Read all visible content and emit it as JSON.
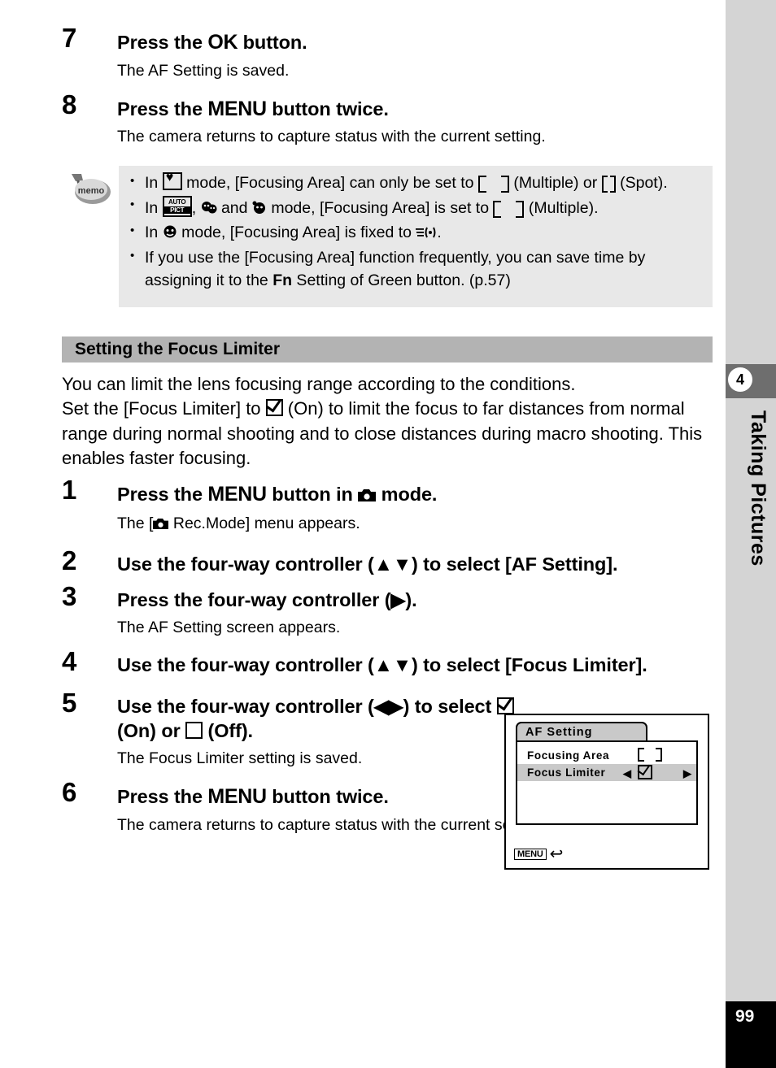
{
  "page": {
    "number": "99",
    "chapter_number": "4",
    "chapter_label": "Taking Pictures"
  },
  "steps_top": [
    {
      "num": "7",
      "title_pre": "Press the ",
      "title_kw": "OK",
      "title_post": " button.",
      "desc": "The AF Setting is saved."
    },
    {
      "num": "8",
      "title_pre": "Press the ",
      "title_kw": "MENU",
      "title_post": " button twice.",
      "desc": "The camera returns to capture status with the current setting."
    }
  ],
  "memo": {
    "icon_label": "memo",
    "items": [
      {
        "seg1": "In ",
        "icon1": "heart-box-icon",
        "seg2": " mode, [Focusing Area] can only be set to ",
        "icon2": "af-frame-multiple-icon",
        "seg3": " (Multiple) or ",
        "icon3": "af-frame-spot-icon",
        "seg4": " (Spot)."
      },
      {
        "seg1": "In ",
        "icon1": "auto-pict-icon",
        "seg2": ", ",
        "icon2": "kids-mode-icon",
        "seg3": " and ",
        "icon3": "pet-mode-icon",
        "seg4": " mode, [Focusing Area] is set to ",
        "icon4": "af-frame-multiple-icon",
        "seg5": " (Multiple)."
      },
      {
        "seg1": "In ",
        "icon1": "half-length-portrait-icon",
        "seg2": " mode, [Focusing Area] is fixed to ",
        "icon2": "pan-focus-icon",
        "seg3": "."
      },
      {
        "seg1": "If you use the [Focusing Area] function frequently, you can save time by assigning it to the ",
        "kw": "Fn",
        "seg2": " Setting of Green button. (p.57)"
      }
    ]
  },
  "section": {
    "heading": "Setting the Focus Limiter",
    "intro_line1": "You can limit the lens focusing range according to the conditions.",
    "intro_line2_a": "Set the [Focus Limiter] to ",
    "intro_line2_icon": "checked-box-icon",
    "intro_line2_b": " (On) to limit the focus to far distances from normal range during normal shooting and to close distances during macro shooting. This enables faster focusing."
  },
  "steps_bottom": [
    {
      "num": "1",
      "title_pre": "Press the ",
      "title_kw": "MENU",
      "title_mid": " button in ",
      "title_icon": "camera-mode-icon",
      "title_post": " mode.",
      "desc_pre": "The [",
      "desc_icon": "camera-mode-icon",
      "desc_post": " Rec.Mode] menu appears."
    },
    {
      "num": "2",
      "title": "Use the four-way controller (▲▼) to select [AF Setting]."
    },
    {
      "num": "3",
      "title": "Press the four-way controller (▶).",
      "desc": "The AF Setting screen appears."
    },
    {
      "num": "4",
      "title": "Use the four-way controller (▲▼) to select [Focus Limiter]."
    },
    {
      "num": "5",
      "title_a": "Use the four-way controller (◀▶) to select ",
      "title_icon_on": "checked-box-icon",
      "title_b": " (On) or ",
      "title_icon_off": "empty-box-icon",
      "title_c": " (Off).",
      "desc": "The Focus Limiter setting is saved."
    },
    {
      "num": "6",
      "title_pre": "Press the ",
      "title_kw": "MENU",
      "title_post": " button twice.",
      "desc": "The camera returns to capture status with the current setting."
    }
  ],
  "lcd": {
    "title": "AF Setting",
    "rows": [
      {
        "label": "Focusing Area",
        "value_icon": "af-frame-multiple-icon"
      },
      {
        "label": "Focus Limiter",
        "value_icon": "checked-box-icon",
        "caret_left": "◀",
        "caret_right": "▶",
        "selected": true
      }
    ],
    "menu_button": "MENU",
    "return_icon": "return-arrow-icon"
  },
  "icons": {
    "auto_pict_top": "AUTO",
    "auto_pict_bottom": "PICT"
  },
  "colors": {
    "memo_bg": "#e8e8e8",
    "heading_bg": "#b3b3b3",
    "rail_bg": "#d4d4d4",
    "tab_bg": "#6e6e6e",
    "lcd_highlight": "#c9c9c9",
    "page_num_bg": "#000000"
  }
}
